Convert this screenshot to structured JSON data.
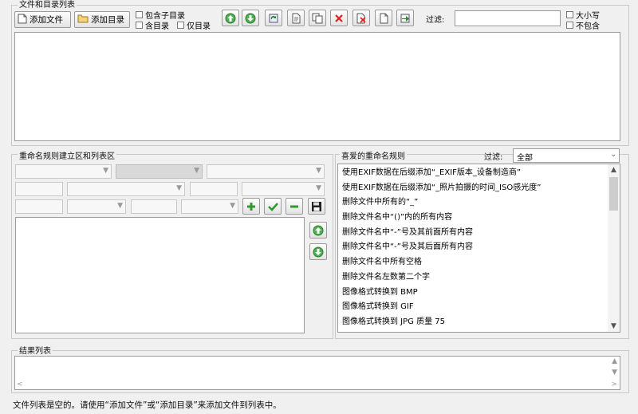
{
  "file_list_section": {
    "title": "文件和目录列表",
    "add_file": "添加文件",
    "add_dir": "添加目录",
    "include_subdir": "包含子目录",
    "include_dir": "含目录",
    "only_dir": "仅目录",
    "filter_label": "过滤:",
    "filter_value": "",
    "case_sensitive": "大小写",
    "exclude": "不包含"
  },
  "rule_build_section": {
    "title": "重命名规则建立区和列表区"
  },
  "favorite_rules_section": {
    "title": "喜爱的重命名规则",
    "filter_label": "过滤:",
    "filter_value": "全部",
    "items": [
      "使用EXIF数据在后缀添加“_EXIF版本_设备制造商”",
      "使用EXIF数据在后缀添加“_照片拍摄的时间_ISO感光度”",
      "删除文件中所有的“_”",
      "删除文件名中“()”内的所有内容",
      "删除文件名中“-”号及其前面所有内容",
      "删除文件名中“-”号及其后面所有内容",
      "删除文件名中所有空格",
      "删除文件名左数第二个字",
      "图像格式转换到 BMP",
      "图像格式转换到 GIF",
      "图像格式转换到 JPG 质量 75"
    ]
  },
  "result_section": {
    "title": "结果列表"
  },
  "status_bar": {
    "text": "文件列表是空的。请使用“添加文件”或“添加目录”来添加文件到列表中。"
  }
}
